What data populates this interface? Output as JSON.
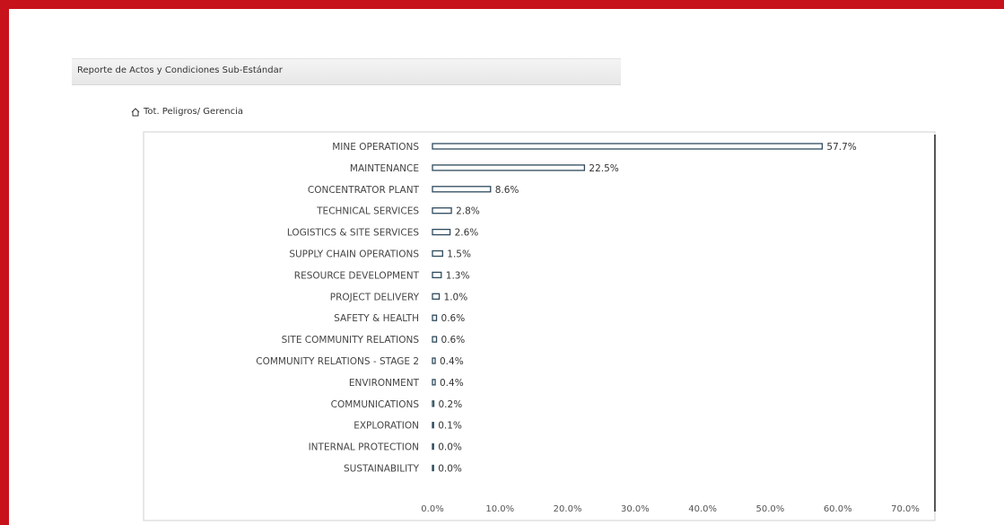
{
  "report": {
    "title": "Reporte de Actos y Condiciones Sub-Estándar"
  },
  "section": {
    "title": "Tot. Peligros/ Gerencia"
  },
  "colors": {
    "frame": "#c8121b",
    "bar_fill": "#ffffff",
    "bar_border": "#2e4a5c"
  },
  "chart_data": {
    "type": "bar",
    "orientation": "horizontal",
    "categories": [
      "MINE OPERATIONS",
      "MAINTENANCE",
      "CONCENTRATOR PLANT",
      "TECHNICAL SERVICES",
      "LOGISTICS & SITE SERVICES",
      "SUPPLY CHAIN OPERATIONS",
      "RESOURCE DEVELOPMENT",
      "PROJECT DELIVERY",
      "SAFETY & HEALTH",
      "SITE COMMUNITY RELATIONS",
      "COMMUNITY RELATIONS - STAGE 2",
      "ENVIRONMENT",
      "COMMUNICATIONS",
      "EXPLORATION",
      "INTERNAL PROTECTION",
      "SUSTAINABILITY"
    ],
    "values": [
      57.7,
      22.5,
      8.6,
      2.8,
      2.6,
      1.5,
      1.3,
      1.0,
      0.6,
      0.6,
      0.4,
      0.4,
      0.2,
      0.1,
      0.0,
      0.0
    ],
    "value_labels": [
      "57.7%",
      "22.5%",
      "8.6%",
      "2.8%",
      "2.6%",
      "1.5%",
      "1.3%",
      "1.0%",
      "0.6%",
      "0.6%",
      "0.4%",
      "0.4%",
      "0.2%",
      "0.1%",
      "0.0%",
      "0.0%"
    ],
    "x_ticks": [
      0,
      10,
      20,
      30,
      40,
      50,
      60,
      70
    ],
    "x_tick_labels": [
      "0.0%",
      "10.0%",
      "20.0%",
      "30.0%",
      "40.0%",
      "50.0%",
      "60.0%",
      "70.0%"
    ],
    "xlim": [
      0,
      75
    ],
    "grid": false,
    "legend": "none"
  }
}
